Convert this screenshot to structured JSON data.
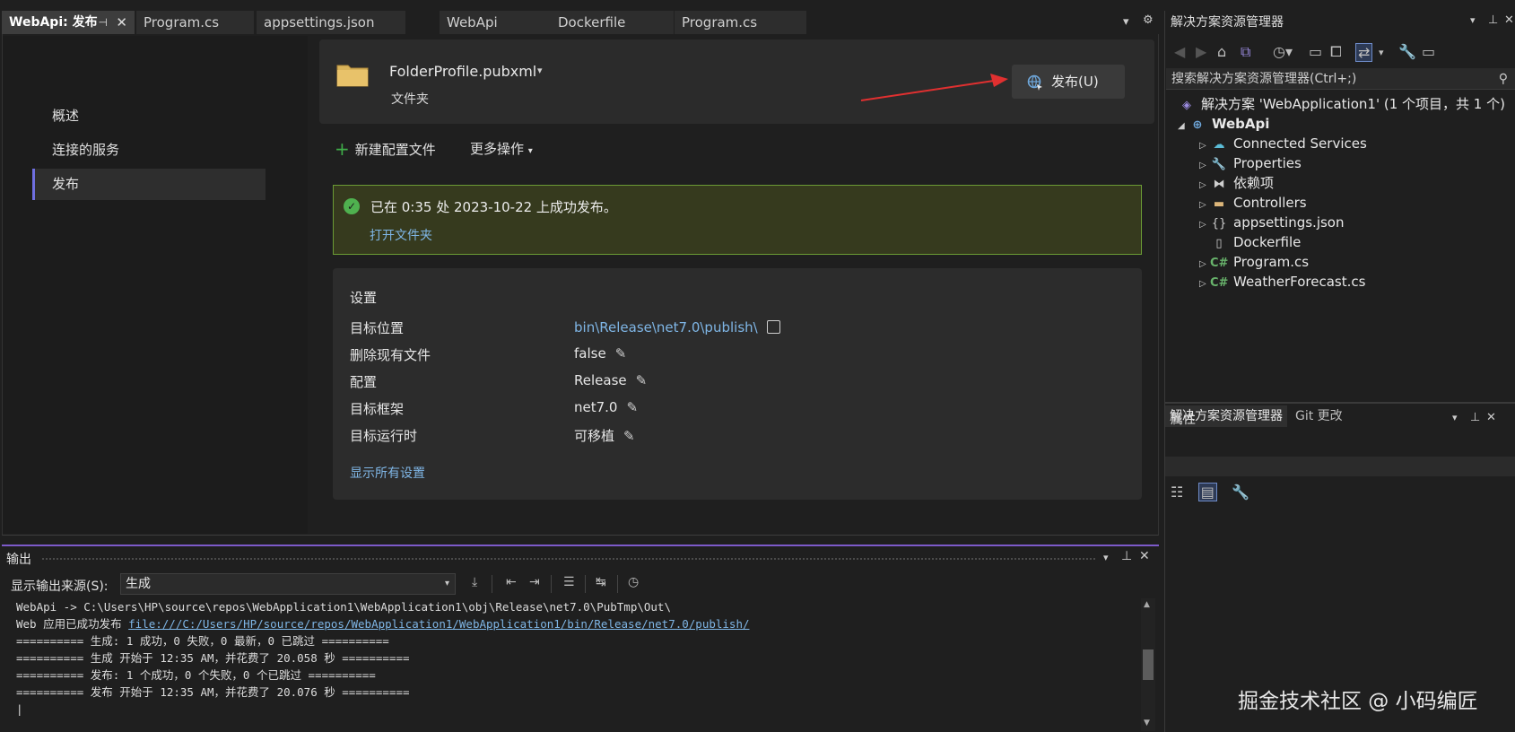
{
  "tabs": [
    {
      "label": "WebApi: 发布",
      "active": true,
      "pin": "⊣",
      "close": "✕"
    },
    {
      "label": "Program.cs"
    },
    {
      "label": "appsettings.json"
    },
    {
      "label": "WebApi"
    },
    {
      "label": "Dockerfile"
    },
    {
      "label": "Program.cs"
    }
  ],
  "tabstrip_controls": {
    "dropdown": "▾",
    "settings": "⚙"
  },
  "leftnav": {
    "items": [
      {
        "label": "概述"
      },
      {
        "label": "连接的服务"
      },
      {
        "label": "发布",
        "selected": true
      }
    ]
  },
  "profile": {
    "name": "FolderProfile.pubxml",
    "caret": "▾",
    "type": "文件夹",
    "publish_button": "发布(U)"
  },
  "actions": {
    "new_profile": "新建配置文件",
    "more_actions": "更多操作",
    "more_caret": "▾"
  },
  "banner": {
    "message": "已在 0:35 处 2023-10-22 上成功发布。",
    "open_folder": "打开文件夹",
    "check": "✓"
  },
  "settings": {
    "title": "设置",
    "rows": [
      {
        "label": "目标位置",
        "value": "bin\\Release\\net7.0\\publish\\",
        "is_link": true
      },
      {
        "label": "删除现有文件",
        "value": "false"
      },
      {
        "label": "配置",
        "value": "Release"
      },
      {
        "label": "目标框架",
        "value": "net7.0"
      },
      {
        "label": "目标运行时",
        "value": "可移植"
      }
    ],
    "edit_glyph": "✎",
    "show_all": "显示所有设置"
  },
  "output": {
    "title": "输出",
    "source_label": "显示输出来源(S):",
    "source_value": "生成",
    "source_caret": "▾",
    "controls": {
      "dropdown": "▾",
      "pin": "⊥",
      "close": "✕"
    },
    "lines": [
      "WebApi -> C:\\Users\\HP\\source\\repos\\WebApplication1\\WebApplication1\\obj\\Release\\net7.0\\PubTmp\\Out\\",
      "Web 应用已成功发布 ",
      "",
      "========== 生成: 1 成功，0 失败，0 最新，0 已跳过 ==========",
      "========== 生成 开始于 12:35 AM，并花费了 20.058 秒 ==========",
      "========== 发布: 1 个成功，0 个失败，0 个已跳过 ==========",
      "========== 发布 开始于 12:35 AM，并花费了 20.076 秒 ==========",
      "|"
    ],
    "publish_link": "file:///C:/Users/HP/source/repos/WebApplication1/WebApplication1/bin/Release/net7.0/publish/"
  },
  "solution_explorer": {
    "title": "解决方案资源管理器",
    "controls": {
      "dropdown": "▾",
      "pin": "⊥",
      "close": "✕"
    },
    "search_placeholder": "搜索解决方案资源管理器(Ctrl+;)",
    "solution_label": "解决方案 'WebApplication1' (1 个项目，共 1 个)",
    "project": "WebApi",
    "nodes": [
      {
        "label": "Connected Services",
        "icon": "cloud-icon"
      },
      {
        "label": "Properties",
        "icon": "wrench-icon"
      },
      {
        "label": "依赖项",
        "icon": "dependencies-icon"
      },
      {
        "label": "Controllers",
        "icon": "folder-icon"
      },
      {
        "label": "appsettings.json",
        "icon": "json-icon"
      },
      {
        "label": "Dockerfile",
        "icon": "file-icon",
        "no_expander": true
      },
      {
        "label": "Program.cs",
        "icon": "csharp-icon"
      },
      {
        "label": "WeatherForecast.cs",
        "icon": "csharp-icon"
      }
    ],
    "tabs": [
      {
        "label": "解决方案资源管理器",
        "active": true
      },
      {
        "label": "Git 更改"
      }
    ]
  },
  "properties_pane": {
    "title": "属性",
    "controls": {
      "dropdown": "▾",
      "pin": "⊥",
      "close": "✕"
    }
  },
  "watermark": "掘金技术社区 @ 小码编匠",
  "colors": {
    "accent": "#7d5ac9",
    "success_border": "#6b9b35",
    "success_bg": "#363a1e",
    "link": "#7fb6e6",
    "arrow": "#e03030"
  }
}
